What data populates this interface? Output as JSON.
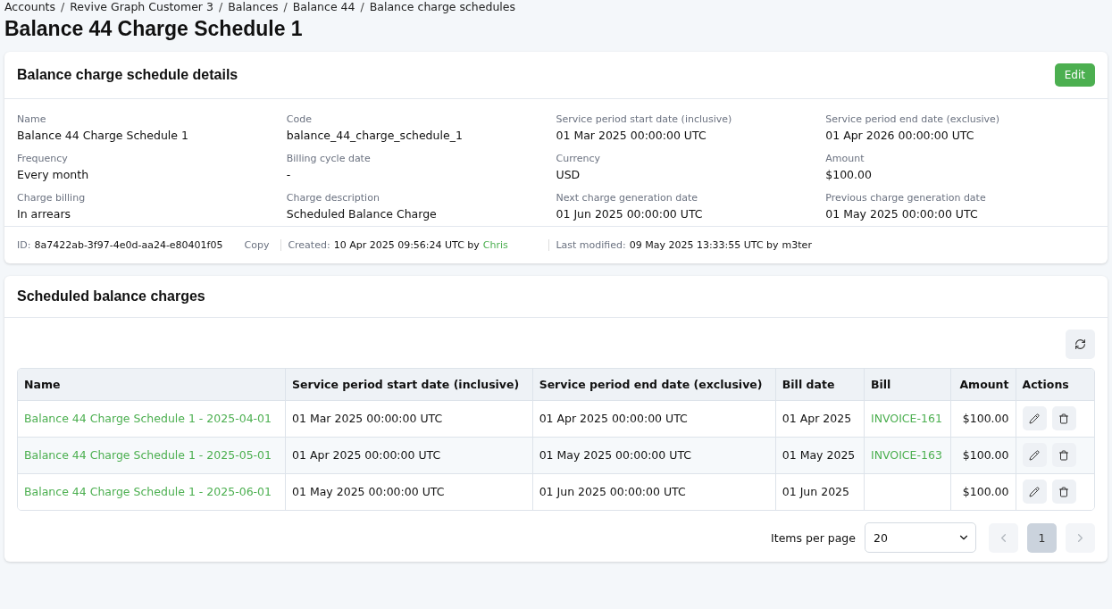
{
  "breadcrumbs": [
    "Accounts",
    "Revive Graph Customer 3",
    "Balances",
    "Balance 44",
    "Balance charge schedules"
  ],
  "breadcrumb_separator": "/",
  "title": "Balance 44 Charge Schedule 1",
  "details": {
    "title": "Balance charge schedule details",
    "edit_button": "Edit",
    "fields": [
      {
        "label": "Name",
        "value": "Balance 44 Charge Schedule 1"
      },
      {
        "label": "Code",
        "value": "balance_44_charge_schedule_1"
      },
      {
        "label": "Service period start date (inclusive)",
        "value": "01 Mar 2025 00:00:00 UTC"
      },
      {
        "label": "Service period end date (exclusive)",
        "value": "01 Apr 2026 00:00:00 UTC"
      },
      {
        "label": "Frequency",
        "value": "Every month"
      },
      {
        "label": "Billing cycle date",
        "value": "-"
      },
      {
        "label": "Currency",
        "value": "USD"
      },
      {
        "label": "Amount",
        "value": "$100.00"
      },
      {
        "label": "Charge billing",
        "value": "In arrears"
      },
      {
        "label": "Charge description",
        "value": "Scheduled Balance Charge"
      },
      {
        "label": "Next charge generation date",
        "value": "01 Jun 2025 00:00:00 UTC"
      },
      {
        "label": "Previous charge generation date",
        "value": "01 May 2025 00:00:00 UTC"
      }
    ],
    "meta": {
      "id_label": "ID:",
      "id": "8a7422ab-3f97-4e0d-aa24-e80401f05",
      "copy": "Copy",
      "created_label": "Created:",
      "created": "10 Apr 2025 09:56:24 UTC by",
      "created_by": "Chris",
      "modified_label": "Last modified:",
      "modified": "09 May 2025 13:33:55 UTC by",
      "modified_by": "m3ter"
    }
  },
  "charges": {
    "title": "Scheduled balance charges",
    "columns": [
      "Name",
      "Service period start date (inclusive)",
      "Service period end date (exclusive)",
      "Bill date",
      "Bill",
      "Amount",
      "Actions"
    ],
    "rows": [
      {
        "name": "Balance 44 Charge Schedule 1 - 2025-04-01",
        "start": "01 Mar 2025 00:00:00 UTC",
        "end": "01 Apr 2025 00:00:00 UTC",
        "bill_date": "01 Apr 2025",
        "bill": "INVOICE-161",
        "amount": "$100.00"
      },
      {
        "name": "Balance 44 Charge Schedule 1 - 2025-05-01",
        "start": "01 Apr 2025 00:00:00 UTC",
        "end": "01 May 2025 00:00:00 UTC",
        "bill_date": "01 May 2025",
        "bill": "INVOICE-163",
        "amount": "$100.00"
      },
      {
        "name": "Balance 44 Charge Schedule 1 - 2025-06-01",
        "start": "01 May 2025 00:00:00 UTC",
        "end": "01 Jun 2025 00:00:00 UTC",
        "bill_date": "01 Jun 2025",
        "bill": "",
        "amount": "$100.00"
      }
    ],
    "pagination": {
      "items_label": "Items per page",
      "page_size": "20",
      "prev_disabled": true,
      "next_disabled": true,
      "pages": [
        {
          "label": "1",
          "selected": true
        }
      ]
    }
  }
}
